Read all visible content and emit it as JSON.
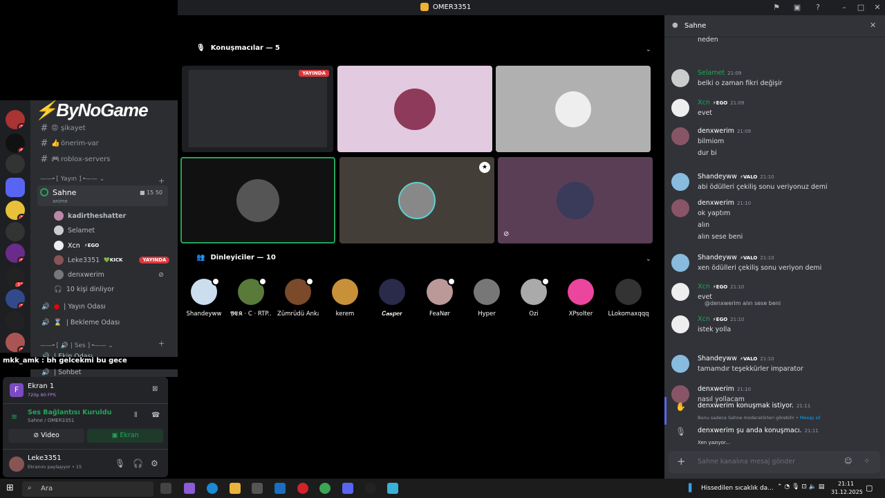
{
  "window": {
    "title": "OMER3351"
  },
  "logo": "ByNoGame",
  "channels": {
    "items": [
      {
        "emoji": "😡",
        "name": "şikayet"
      },
      {
        "emoji": "👍",
        "name": "önerim-var"
      },
      {
        "emoji": "🎮",
        "name": "roblox-servers"
      }
    ],
    "category1": "Yayın",
    "stage": {
      "name": "Sahne",
      "sub": "anime",
      "count1": "15",
      "count2": "50"
    },
    "users": [
      {
        "name": "kadirtheshatter",
        "tag": ""
      },
      {
        "name": "Selamet",
        "tag": ""
      },
      {
        "name": "Xcn",
        "tag": "EGO"
      },
      {
        "name": "Leke3351",
        "tag": "KICK",
        "live": "YAYINDA"
      },
      {
        "name": "denxwerim",
        "tag": ""
      },
      {
        "name": "10 kişi dinliyor",
        "tag": ""
      }
    ],
    "voice": [
      {
        "name": "| Yayın Odası"
      },
      {
        "name": "| Bekleme Odası"
      }
    ],
    "category2": "Ses",
    "voice2": [
      {
        "name": "| Ekip Odası"
      },
      {
        "name": "| Sohbet"
      }
    ]
  },
  "overlay_text": "mkk_amk : bh gelcekmi bu gece",
  "panel": {
    "screen_name": "Ekran 1",
    "screen_sub": "720p 60 FPS",
    "voice_status": "Ses Bağlantısı Kuruldu",
    "voice_sub": "Sahne / OMER3351",
    "video_label": "Video",
    "screen_label": "Ekran",
    "user_name": "Leke3351",
    "user_status": "Ekranını paylaşıyor • 15"
  },
  "stage": {
    "speakers_label": "Konuşmacılar — 5",
    "listeners_label": "Dinleyiciler — 10",
    "live_badge": "YAYINDA",
    "listeners": [
      "Shandeyww",
      "𝖄𝕰𝕶 · C · RTP...",
      "Zümrüdü Anka",
      "kerem",
      "𝑪𝒂𝒔𝒑𝒆𝒓",
      "FeaÑør",
      "Hyper",
      "Ozi",
      "XPsolter",
      "LLokomaxqqq"
    ]
  },
  "chat": {
    "title": "Sahne",
    "top_text": "neden",
    "messages": [
      {
        "name": "Selamet",
        "time": "21:09",
        "lines": [
          "belki o zaman fikri değişir"
        ],
        "color": "#23a55a"
      },
      {
        "name": "Xcn",
        "badge": "EGO",
        "time": "21:09",
        "lines": [
          "evet"
        ],
        "color": "#23a55a"
      },
      {
        "name": "denxwerim",
        "time": "21:09",
        "lines": [
          "bilmiom",
          "dur bi"
        ],
        "color": "#ffffff"
      },
      {
        "name": "Shandeyww",
        "badge": "VALO",
        "time": "21:10",
        "lines": [
          "abi ödülleri çekiliş sonu veriyonuz demi"
        ],
        "color": "#ffffff"
      },
      {
        "name": "denxwerim",
        "time": "21:10",
        "lines": [
          "ok yaptım",
          "alın",
          "alın sese beni"
        ],
        "color": "#ffffff"
      },
      {
        "name": "Shandeyww",
        "badge": "VALO",
        "time": "21:10",
        "lines": [
          "xen ödülleri çekiliş sonu veriyon demi"
        ],
        "color": "#ffffff"
      },
      {
        "name": "Xcn",
        "badge": "EGO",
        "time": "21:10",
        "lines": [
          "evet"
        ],
        "color": "#23a55a"
      },
      {
        "name": "Xcn",
        "badge": "EGO",
        "time": "21:10",
        "lines": [
          "istek yolla"
        ],
        "color": "#23a55a",
        "reply": "@denxwerim alın sese beni"
      },
      {
        "name": "Shandeyww",
        "badge": "VALO",
        "time": "21:10",
        "lines": [
          "tamamdır teşekkürler imparator"
        ],
        "color": "#ffffff"
      },
      {
        "name": "denxwerim",
        "time": "21:10",
        "lines": [
          "nasıl yollacam"
        ],
        "color": "#ffffff"
      }
    ],
    "request": {
      "text": "denxwerim konuşmak istiyor.",
      "time": "21:11",
      "sub": "Bunu sadece Sahne moderatörleri görebilir •",
      "link": "Mesajı sil"
    },
    "speaker_now": {
      "text": "denxwerim şu anda konuşmacı.",
      "time": "21:11"
    },
    "typing": "Xen yazıyor...",
    "input_placeholder": "Sahne kanalına mesaj gönder"
  },
  "taskbar": {
    "search_placeholder": "Ara",
    "weather": "Hissedilen sıcaklık da...",
    "time": "21:11",
    "date": "31.12.2025"
  }
}
